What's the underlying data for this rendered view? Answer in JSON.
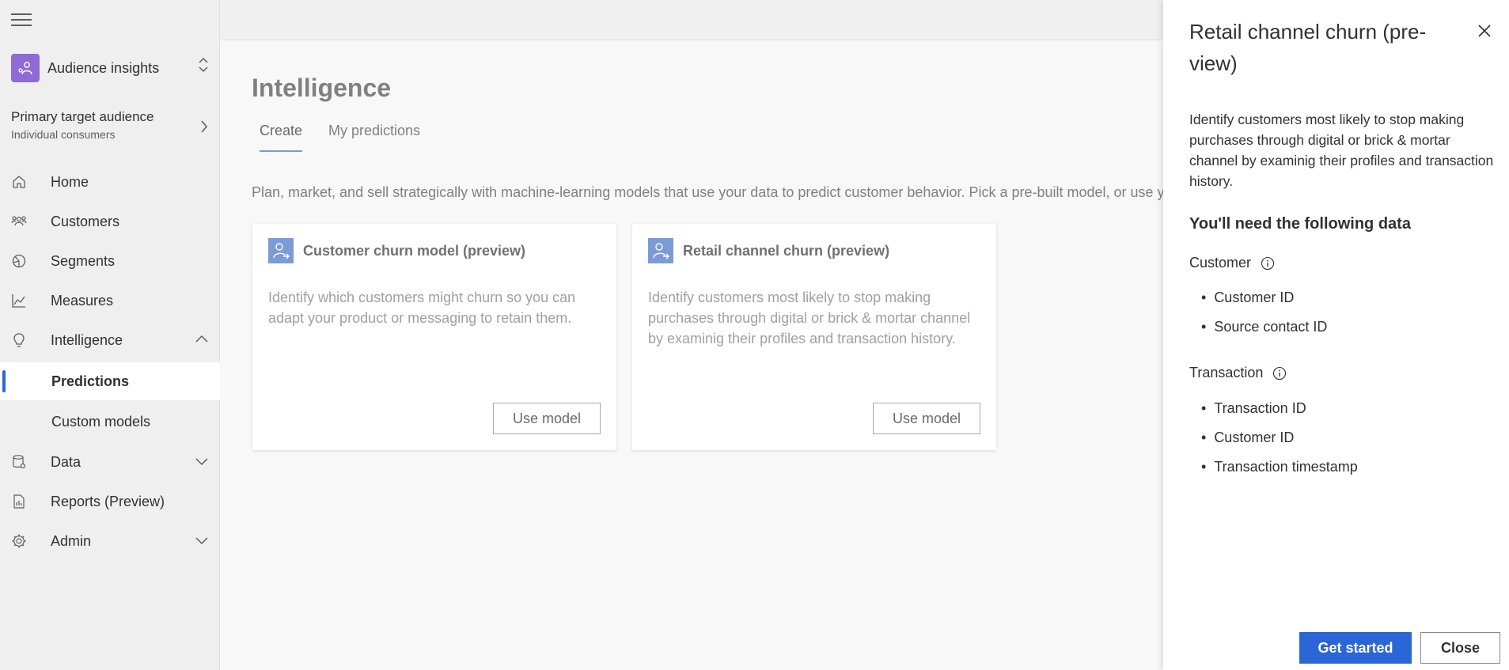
{
  "nav": {
    "app_name": "Audience insights",
    "audience_title": "Primary target audience",
    "audience_subtitle": "Individual consumers",
    "items": [
      {
        "label": "Home",
        "icon": "home-icon"
      },
      {
        "label": "Customers",
        "icon": "people-icon"
      },
      {
        "label": "Segments",
        "icon": "segments-icon"
      },
      {
        "label": "Measures",
        "icon": "chart-icon"
      },
      {
        "label": "Intelligence",
        "icon": "lightbulb-icon"
      },
      {
        "label": "Data",
        "icon": "database-icon"
      },
      {
        "label": "Reports (Preview)",
        "icon": "report-icon"
      },
      {
        "label": "Admin",
        "icon": "gear-icon"
      }
    ],
    "sub_items": [
      {
        "label": "Predictions",
        "active": true
      },
      {
        "label": "Custom models",
        "active": false
      }
    ]
  },
  "main": {
    "title": "Intelligence",
    "tabs": [
      {
        "label": "Create",
        "active": true
      },
      {
        "label": "My predictions",
        "active": false
      }
    ],
    "intro": "Plan, market, and sell strategically with machine-learning models that use your data to predict customer behavior. Pick a pre-built model, or use your c",
    "cards": [
      {
        "title": "Customer churn model (preview)",
        "description": "Identify which customers might churn so you can adapt your product or messaging to retain them.",
        "button": "Use model"
      },
      {
        "title": "Retail channel churn (preview)",
        "description": "Identify customers most likely to stop making purchases through digital or brick & mortar channel by examinig their profiles and transaction history.",
        "button": "Use model"
      }
    ]
  },
  "panel": {
    "title": "Retail channel churn (pre-view)",
    "description": "Identify customers most likely to stop making purchases through digital or brick & mortar channel by examinig their profiles and transaction history.",
    "heading": "You'll need the following data",
    "groups": [
      {
        "label": "Customer",
        "items": [
          "Customer ID",
          "Source contact ID"
        ]
      },
      {
        "label": "Transaction",
        "items": [
          "Transaction ID",
          "Customer ID",
          "Transaction timestamp"
        ]
      }
    ],
    "primary_button": "Get started",
    "secondary_button": "Close"
  },
  "colors": {
    "accent": "#2b66d6",
    "app_icon": "#8d6ad6",
    "card_icon": "#7b9ad6"
  }
}
